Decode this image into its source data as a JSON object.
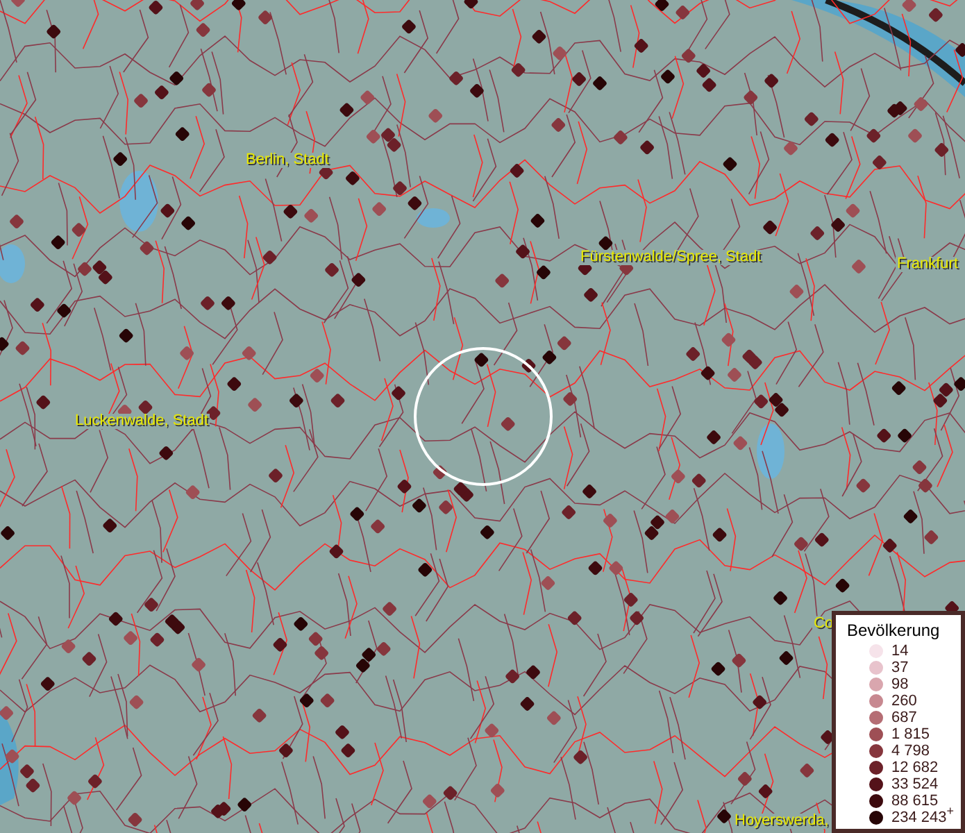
{
  "map_labels": [
    {
      "text": "Berlin, Stadt"
    },
    {
      "text": "Fürstenwalde/Spree, Stadt"
    },
    {
      "text": "Frankfurt"
    },
    {
      "text": "Luckenwalde, Stadt"
    },
    {
      "text": "Co"
    },
    {
      "text": "Hoyerswerda,"
    }
  ],
  "legend": {
    "title": "Bevölkerung",
    "items": [
      {
        "label": "14",
        "color": "#f6e3ea"
      },
      {
        "label": "37",
        "color": "#e8c3cc"
      },
      {
        "label": "98",
        "color": "#d9a6ae"
      },
      {
        "label": "260",
        "color": "#c78890"
      },
      {
        "label": "687",
        "color": "#b56d74"
      },
      {
        "label": "1 815",
        "color": "#9e4f55"
      },
      {
        "label": "4 798",
        "color": "#86363d"
      },
      {
        "label": "12 682",
        "color": "#6c2129"
      },
      {
        "label": "33 524",
        "color": "#541219"
      },
      {
        "label": "88 615",
        "color": "#3d0a0e"
      },
      {
        "label": "234 243",
        "color": "#270506",
        "suffix": "+"
      }
    ]
  }
}
